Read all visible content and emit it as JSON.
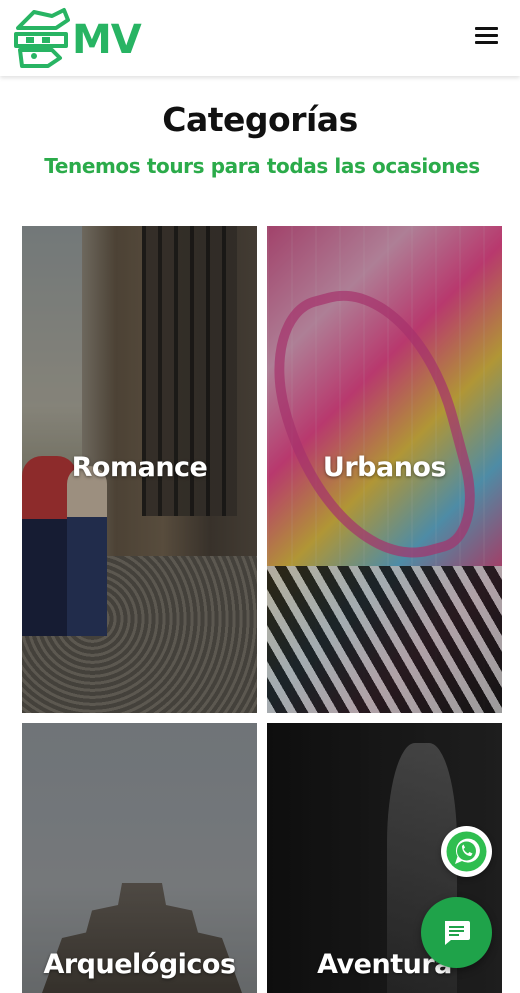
{
  "header": {
    "logo_text": "MV",
    "logo_icon": "aztec-mask-icon",
    "menu_icon": "hamburger-menu-icon"
  },
  "main": {
    "title": "Categorías",
    "subtitle": "Tenemos tours para todas las ocasiones",
    "categories": [
      {
        "label": "Romance"
      },
      {
        "label": "Urbanos"
      },
      {
        "label": "Arquelógicos"
      },
      {
        "label": "Aventura"
      }
    ]
  },
  "floating": {
    "whatsapp_icon": "whatsapp-icon",
    "chat_icon": "chat-icon"
  },
  "colors": {
    "brand_green": "#28b463",
    "subtitle_green": "#2bab4a",
    "chat_button": "#1fa34a"
  }
}
